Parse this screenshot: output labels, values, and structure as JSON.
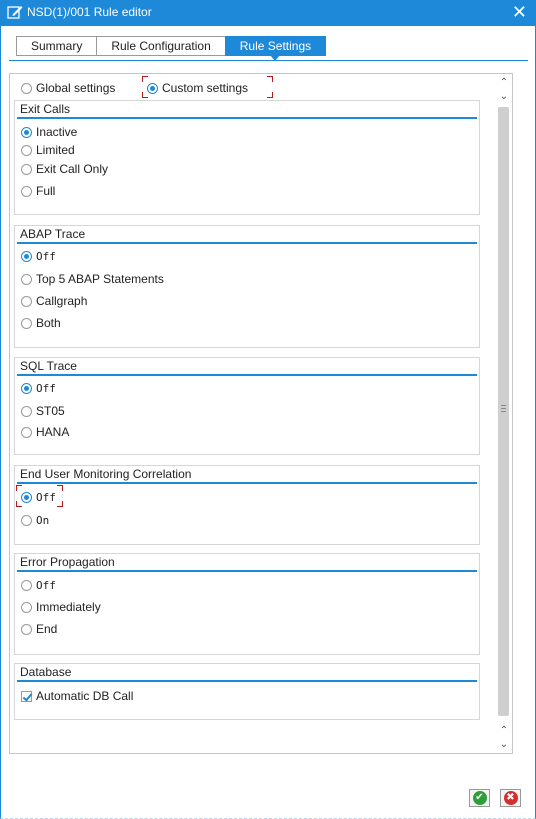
{
  "window": {
    "title": "NSD(1)/001 Rule editor",
    "close_glyph": "✕",
    "icon": "edit-document-icon"
  },
  "tabs": [
    {
      "label": "Summary",
      "active": false
    },
    {
      "label": "Rule Configuration",
      "active": false
    },
    {
      "label": "Rule Settings",
      "active": true
    }
  ],
  "settings_scope": {
    "global_label": "Global settings",
    "custom_label": "Custom settings",
    "selected": "custom"
  },
  "groups": {
    "exit_calls": {
      "title": "Exit Calls",
      "options": [
        "Inactive",
        "Limited",
        "Exit Call Only",
        "Full"
      ],
      "selected": 0
    },
    "abap_trace": {
      "title": "ABAP Trace",
      "options": [
        "Off",
        "Top 5 ABAP Statements",
        "Callgraph",
        "Both"
      ],
      "selected": 0
    },
    "sql_trace": {
      "title": "SQL Trace",
      "options": [
        "Off",
        "ST05",
        "HANA"
      ],
      "selected": 0
    },
    "eum_correlation": {
      "title": "End User Monitoring Correlation",
      "options": [
        "Off",
        "On"
      ],
      "selected": 0
    },
    "error_propagation": {
      "title": "Error Propagation",
      "options": [
        "Off",
        "Immediately",
        "End"
      ],
      "selected": null
    },
    "database": {
      "title": "Database",
      "checkbox_label": "Automatic DB Call",
      "checked": true
    }
  },
  "footer": {
    "ok_icon": "check-icon",
    "ok_glyph": "✔",
    "ok_color": "#2e9e3a",
    "cancel_icon": "cancel-icon",
    "cancel_glyph": "✖",
    "cancel_color": "#d32f2f"
  },
  "colors": {
    "accent": "#1e88d9",
    "focus": "#b71c1c"
  }
}
